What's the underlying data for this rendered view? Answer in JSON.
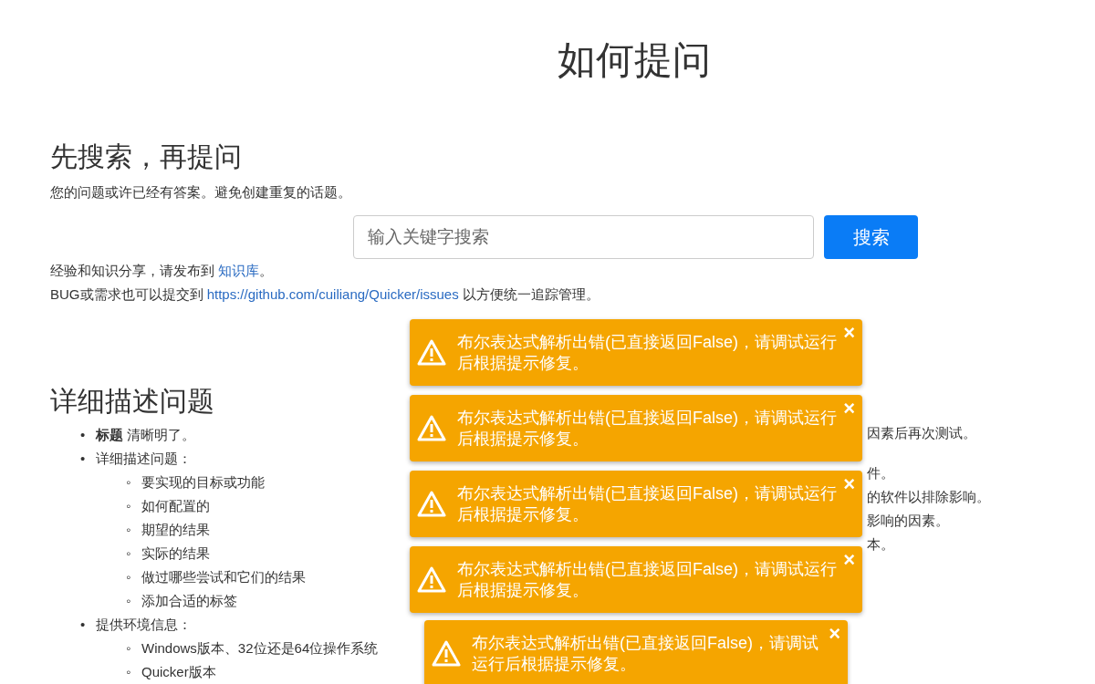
{
  "title": "如何提问",
  "search_section": {
    "heading": "先搜索，再提问",
    "intro": "您的问题或许已经有答案。避免创建重复的话题。",
    "search": {
      "placeholder": "输入关键字搜索",
      "button": "搜索"
    },
    "notes": [
      {
        "text": "经验和知识分享，请发布到 ",
        "link": "知识库",
        "after": "。"
      },
      {
        "text": "BUG或需求也可以提交到 ",
        "link": "https://github.com/cuiliang/Quicker/issues",
        "after": " 以方便统一追踪管理。"
      }
    ]
  },
  "detail_section": {
    "heading": "详细描述问题",
    "items": [
      {
        "marker": "•",
        "text": "**标题** 清晰明了。"
      },
      {
        "marker": "•",
        "text": "详细描述问题：",
        "children": [
          {
            "marker": "◦",
            "text": "要实现的目标或功能"
          },
          {
            "marker": "◦",
            "text": "如何配置的"
          },
          {
            "marker": "◦",
            "text": "期望的结果"
          },
          {
            "marker": "◦",
            "text": "实际的结果"
          },
          {
            "marker": "◦",
            "text": "做过哪些尝试和它们的结果"
          },
          {
            "marker": "◦",
            "text": "添加合适的标签"
          }
        ]
      },
      {
        "marker": "•",
        "text": "提供环境信息：",
        "children": [
          {
            "marker": "◦",
            "text": "Windows版本、32位还是64位操作系统"
          },
          {
            "marker": "◦",
            "text": "Quicker版本"
          }
        ]
      }
    ]
  },
  "right_column_fragments": [
    "因素后再次测试。",
    "件。",
    "的软件以排除影响。",
    "影响的因素。",
    "本。"
  ],
  "toasts": [
    {
      "message": "布尔表达式解析出错(已直接返回False)，请调试运行后根据提示修复。",
      "close": "×"
    },
    {
      "message": "布尔表达式解析出错(已直接返回False)，请调试运行后根据提示修复。",
      "close": "×"
    },
    {
      "message": "布尔表达式解析出错(已直接返回False)，请调试运行后根据提示修复。",
      "close": "×"
    },
    {
      "message": "布尔表达式解析出错(已直接返回False)，请调试运行后根据提示修复。",
      "close": "×"
    },
    {
      "message": "布尔表达式解析出错(已直接返回False)，请调试运行后根据提示修复。",
      "close": "×"
    }
  ]
}
